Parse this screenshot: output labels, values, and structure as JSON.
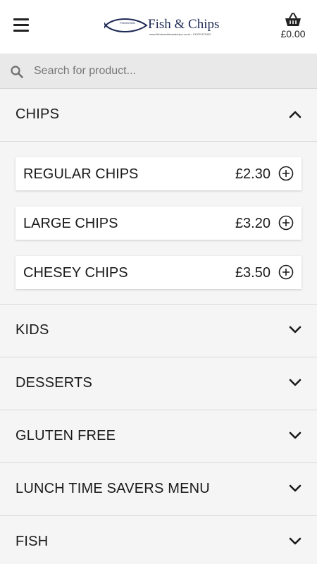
{
  "header": {
    "logo_title": "Fish & Chips",
    "logo_fish_text": "FISHDOWN",
    "logo_subtitle": "www.fishdownfishandchips.co.uk • 01202 872492",
    "basket_total": "£0.00"
  },
  "search": {
    "placeholder": "Search for product..."
  },
  "categories": [
    {
      "label": "CHIPS",
      "expanded": true,
      "items": [
        {
          "name": "REGULAR CHIPS",
          "price": "£2.30"
        },
        {
          "name": "LARGE CHIPS",
          "price": "£3.20"
        },
        {
          "name": "CHESEY CHIPS",
          "price": "£3.50"
        }
      ]
    },
    {
      "label": "KIDS",
      "expanded": false
    },
    {
      "label": "DESSERTS",
      "expanded": false
    },
    {
      "label": "GLUTEN FREE",
      "expanded": false
    },
    {
      "label": "LUNCH TIME SAVERS MENU",
      "expanded": false
    },
    {
      "label": "FISH",
      "expanded": false
    }
  ],
  "icons": {
    "menu": "hamburger-menu-icon",
    "basket": "basket-icon",
    "search": "search-icon",
    "add": "plus-circle-icon",
    "expanded": "chevron-up-icon",
    "collapsed": "chevron-down-icon"
  },
  "colors": {
    "logo_navy": "#1d2a55",
    "background": "#f5f5f5",
    "search_bar": "#e9e9e9"
  }
}
